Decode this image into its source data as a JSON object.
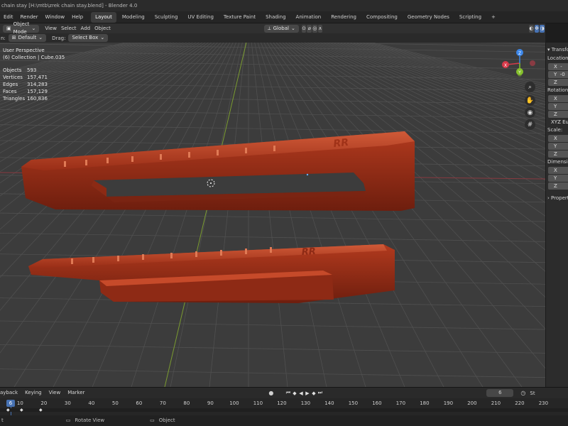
{
  "window": {
    "title": "chain stay [H:\\mtb\\zrek chain stay.blend] - Blender 4.0"
  },
  "top_menu": [
    "Edit",
    "Render",
    "Window",
    "Help"
  ],
  "workspace_tabs": [
    {
      "label": "Layout",
      "active": true
    },
    {
      "label": "Modeling"
    },
    {
      "label": "Sculpting"
    },
    {
      "label": "UV Editing"
    },
    {
      "label": "Texture Paint"
    },
    {
      "label": "Shading"
    },
    {
      "label": "Animation"
    },
    {
      "label": "Rendering"
    },
    {
      "label": "Compositing"
    },
    {
      "label": "Geometry Nodes"
    },
    {
      "label": "Scripting"
    }
  ],
  "viewport_header": {
    "partial_left": "n:",
    "orientation": "Default",
    "drag_label": "Drag:",
    "drag_value": "Select Box",
    "mode": "Object Mode",
    "menus": [
      "View",
      "Select",
      "Add",
      "Object"
    ],
    "transform_orientation": "Global"
  },
  "overlay": {
    "view_name": "User Perspective",
    "collection": "(6) Collection | Cube.035",
    "stats": [
      {
        "label": "Objects",
        "value": "593"
      },
      {
        "label": "Vertices",
        "value": "157,471"
      },
      {
        "label": "Edges",
        "value": "314,283"
      },
      {
        "label": "Faces",
        "value": "157,129"
      },
      {
        "label": "Triangles",
        "value": "160,836"
      }
    ]
  },
  "gizmo": {
    "x": "X",
    "y": "Y",
    "z": "Z"
  },
  "sidebar": {
    "section_transform": "Transfo",
    "location_label": "Location:",
    "location": [
      {
        "axis": "X",
        "value": "-"
      },
      {
        "axis": "Y",
        "value": "-0"
      },
      {
        "axis": "Z",
        "value": ""
      }
    ],
    "rotation_label": "Rotation:",
    "rotation": [
      {
        "axis": "X"
      },
      {
        "axis": "Y"
      },
      {
        "axis": "Z"
      }
    ],
    "rotation_mode": "XYZ Eule",
    "scale_label": "Scale:",
    "scale": [
      {
        "axis": "X"
      },
      {
        "axis": "Y"
      },
      {
        "axis": "Z"
      }
    ],
    "dimensions_label": "Dimension",
    "dimensions": [
      {
        "axis": "X"
      },
      {
        "axis": "Y"
      },
      {
        "axis": "Z"
      }
    ],
    "section_properties": "Propert"
  },
  "timeline": {
    "menus": [
      "ayback",
      "Keying",
      "View",
      "Marker"
    ],
    "current_frame": "6",
    "start_partial": "St",
    "frame_marks": [
      "6",
      "10",
      "20",
      "30",
      "40",
      "50",
      "60",
      "70",
      "80",
      "90",
      "100",
      "110",
      "120",
      "130",
      "140",
      "150",
      "160",
      "170",
      "180",
      "190",
      "200",
      "210",
      "220",
      "230"
    ],
    "current_frame_value": 6
  },
  "statusbar": {
    "left": "t",
    "rotate_view": "Rotate View",
    "object": "Object"
  },
  "colors": {
    "accent": "#4772b3",
    "model": "#b33b1f",
    "x_axis": "#d6394a",
    "y_axis": "#85c02c",
    "z_axis": "#3c86e8"
  }
}
